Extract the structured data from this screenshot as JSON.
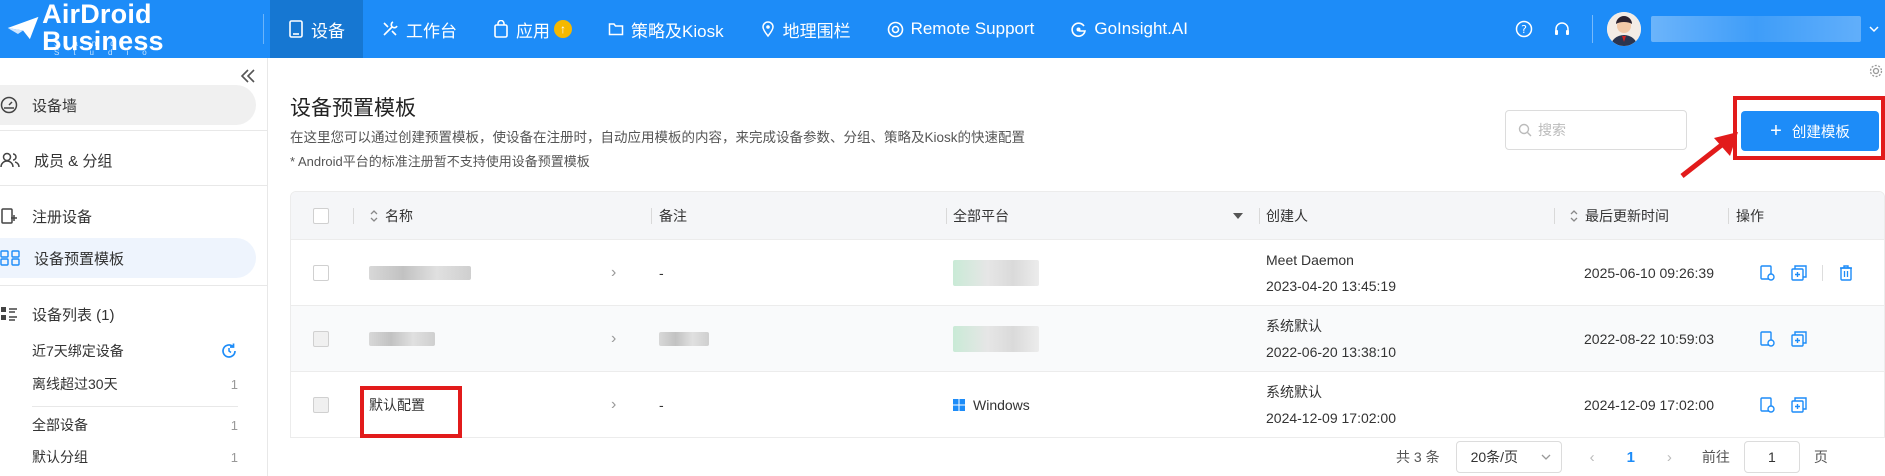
{
  "brand": {
    "name": "AirDroid Business",
    "subtitle": "Sand Studio"
  },
  "nav": {
    "items": [
      {
        "label": "设备",
        "icon": "tablet-icon",
        "active": true
      },
      {
        "label": "工作台",
        "icon": "tools-icon"
      },
      {
        "label": "应用",
        "icon": "bag-icon",
        "badge": "↑"
      },
      {
        "label": "策略及Kiosk",
        "icon": "folder-icon"
      },
      {
        "label": "地理围栏",
        "icon": "map-pin-icon"
      },
      {
        "label": "Remote Support",
        "icon": "lifebuoy-icon"
      },
      {
        "label": "GoInsight.AI",
        "icon": "ai-icon"
      }
    ]
  },
  "sidebar": {
    "items": [
      {
        "label": "设备墙",
        "icon": "dashboard-icon"
      },
      {
        "label": "成员 & 分组",
        "icon": "users-icon"
      },
      {
        "label": "注册设备",
        "icon": "enroll-icon"
      },
      {
        "label": "设备预置模板",
        "icon": "template-icon"
      },
      {
        "label": "设备列表 (1)",
        "icon": "list-icon"
      }
    ],
    "filters": [
      {
        "label": "近7天绑定设备",
        "count": ""
      },
      {
        "label": "离线超过30天",
        "count": "1"
      },
      {
        "label": "全部设备",
        "count": "1"
      },
      {
        "label": "默认分组",
        "count": "1"
      }
    ]
  },
  "page": {
    "title": "设备预置模板",
    "description": "在这里您可以通过创建预置模板，使设备在注册时，自动应用模板的内容，来完成设备参数、分组、策略及Kiosk的快速配置",
    "note": "* Android平台的标准注册暂不支持使用设备预置模板",
    "search_placeholder": "搜索",
    "create_label": "创建模板"
  },
  "table": {
    "columns": {
      "name": "名称",
      "remark": "备注",
      "platform": "全部平台",
      "creator": "创建人",
      "updated": "最后更新时间",
      "actions": "操作"
    },
    "rows": [
      {
        "name": "",
        "remark": "-",
        "platform": "",
        "creator": "Meet Daemon",
        "created": "2023-04-20 13:45:19",
        "updated": "2025-06-10 09:26:39",
        "deletable": true
      },
      {
        "name": "",
        "remark": "",
        "platform": "",
        "creator": "系统默认",
        "created": "2022-06-20 13:38:10",
        "updated": "2022-08-22 10:59:03",
        "deletable": false
      },
      {
        "name": "默认配置",
        "remark": "-",
        "platform": "Windows",
        "creator": "系统默认",
        "created": "2024-12-09 17:02:00",
        "updated": "2024-12-09 17:02:00",
        "deletable": false
      }
    ]
  },
  "pagination": {
    "total": "共 3 条",
    "per_page": "20条/页",
    "current": "1",
    "goto_label": "前往",
    "goto_value": "1",
    "page_suffix": "页"
  },
  "colors": {
    "primary": "#1d8cf8",
    "highlight": "#e21b1b"
  }
}
